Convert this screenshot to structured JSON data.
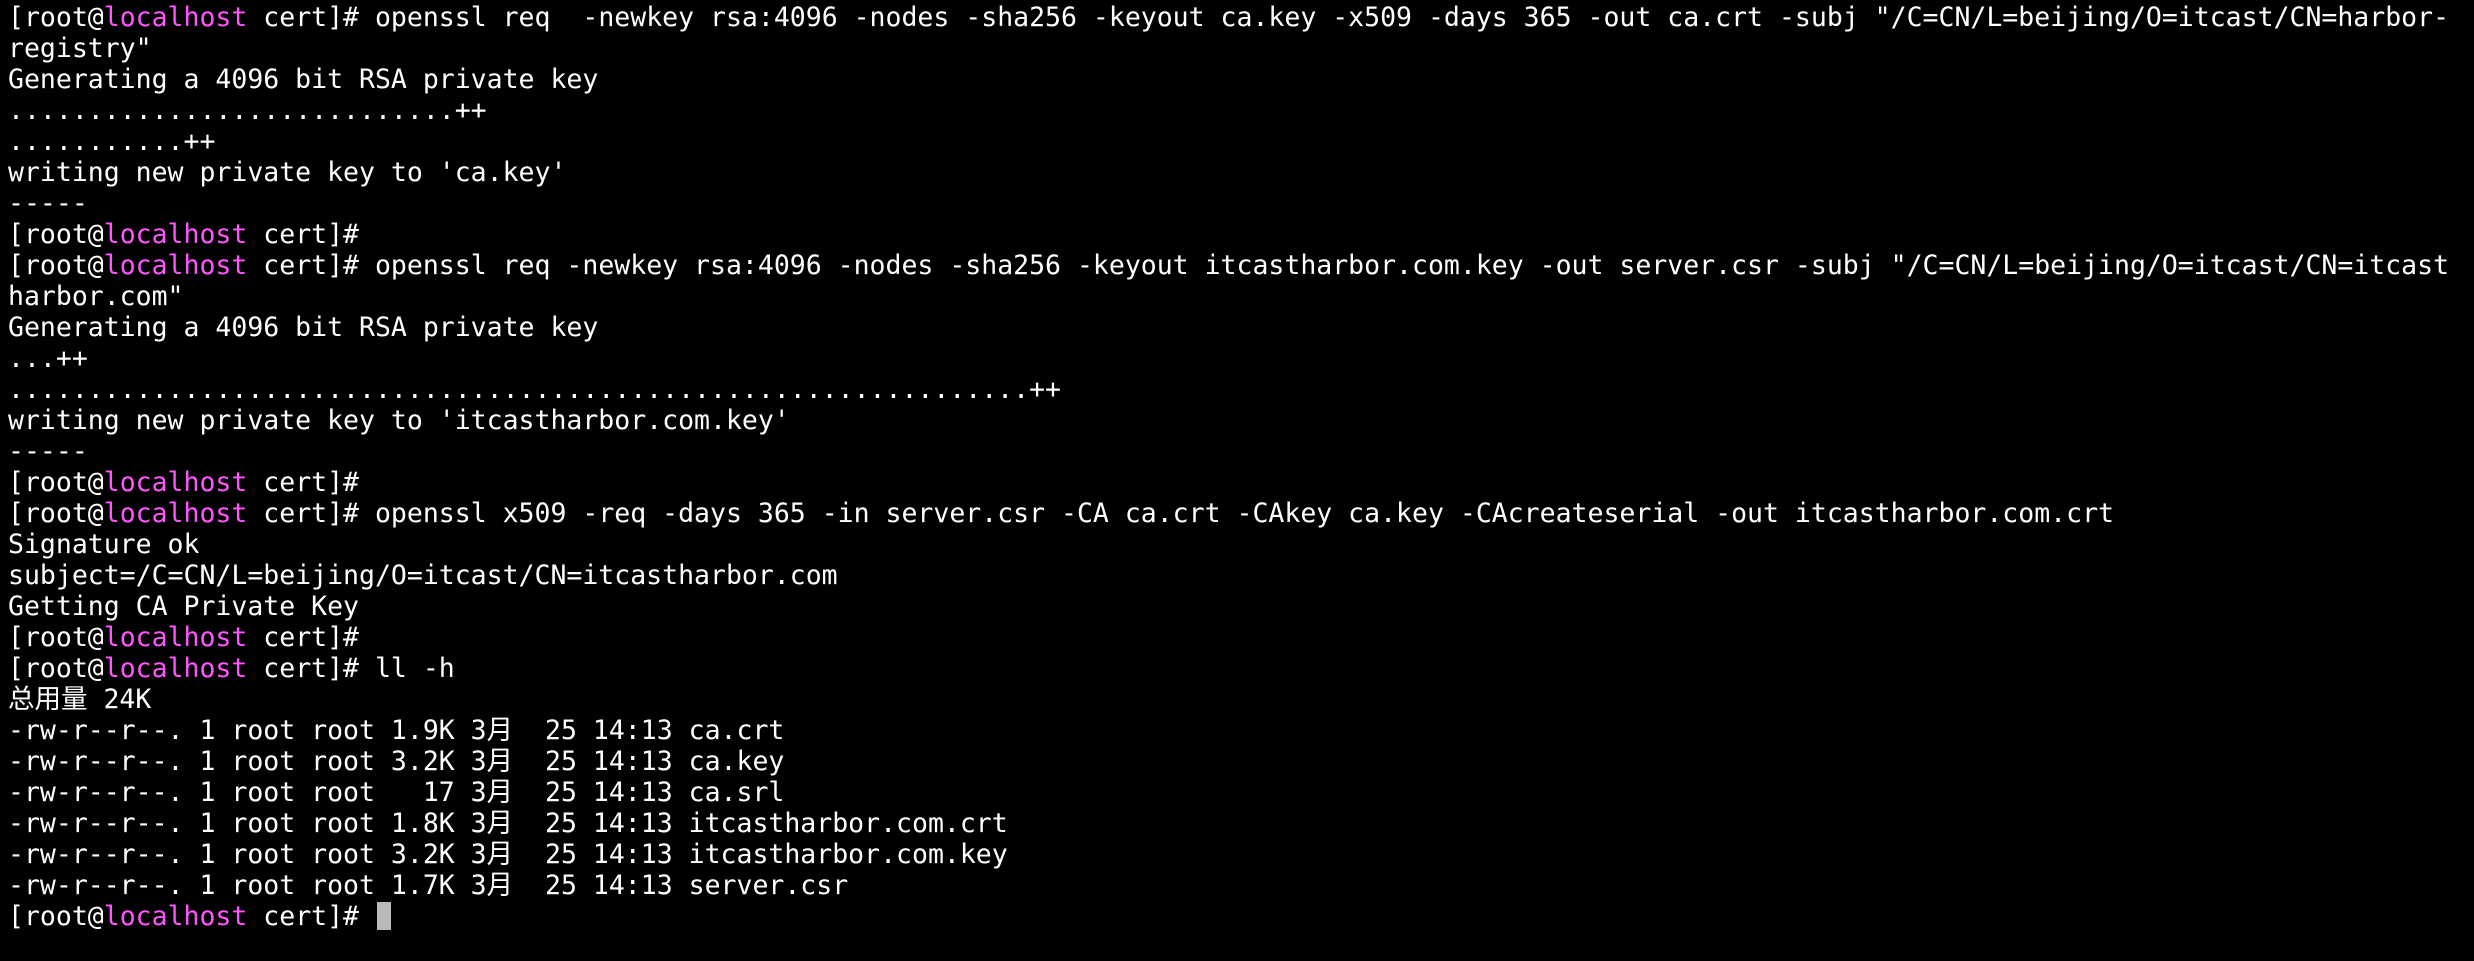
{
  "prompt": {
    "user": "[root@",
    "host": "localhost",
    "rest": " cert]# "
  },
  "cursor_icon": "block-cursor",
  "colors": {
    "background": "#000000",
    "text": "#ffffff",
    "hostname": "#ff55ff",
    "cursor": "#b8b8b8"
  },
  "lines": [
    {
      "type": "prompt",
      "cmd": "openssl req  -newkey rsa:4096 -nodes -sha256 -keyout ca.key -x509 -days 365 -out ca.crt -subj \"/C=CN/L=beijing/O=itcast/CN=harbor-"
    },
    {
      "type": "text",
      "text": "registry\""
    },
    {
      "type": "text",
      "text": "Generating a 4096 bit RSA private key"
    },
    {
      "type": "text",
      "text": "............................++"
    },
    {
      "type": "text",
      "text": "...........++"
    },
    {
      "type": "text",
      "text": "writing new private key to 'ca.key'"
    },
    {
      "type": "text",
      "text": "-----"
    },
    {
      "type": "prompt",
      "cmd": ""
    },
    {
      "type": "prompt",
      "cmd": "openssl req -newkey rsa:4096 -nodes -sha256 -keyout itcastharbor.com.key -out server.csr -subj \"/C=CN/L=beijing/O=itcast/CN=itcast"
    },
    {
      "type": "text",
      "text": "harbor.com\""
    },
    {
      "type": "text",
      "text": "Generating a 4096 bit RSA private key"
    },
    {
      "type": "text",
      "text": "...++"
    },
    {
      "type": "text",
      "text": "................................................................++"
    },
    {
      "type": "text",
      "text": "writing new private key to 'itcastharbor.com.key'"
    },
    {
      "type": "text",
      "text": "-----"
    },
    {
      "type": "prompt",
      "cmd": ""
    },
    {
      "type": "prompt",
      "cmd": "openssl x509 -req -days 365 -in server.csr -CA ca.crt -CAkey ca.key -CAcreateserial -out itcastharbor.com.crt"
    },
    {
      "type": "text",
      "text": "Signature ok"
    },
    {
      "type": "text",
      "text": "subject=/C=CN/L=beijing/O=itcast/CN=itcastharbor.com"
    },
    {
      "type": "text",
      "text": "Getting CA Private Key"
    },
    {
      "type": "prompt",
      "cmd": ""
    },
    {
      "type": "prompt",
      "cmd": "ll -h"
    },
    {
      "type": "text",
      "text": "总用量 24K"
    },
    {
      "type": "text",
      "text": "-rw-r--r--. 1 root root 1.9K 3月  25 14:13 ca.crt"
    },
    {
      "type": "text",
      "text": "-rw-r--r--. 1 root root 3.2K 3月  25 14:13 ca.key"
    },
    {
      "type": "text",
      "text": "-rw-r--r--. 1 root root   17 3月  25 14:13 ca.srl"
    },
    {
      "type": "text",
      "text": "-rw-r--r--. 1 root root 1.8K 3月  25 14:13 itcastharbor.com.crt"
    },
    {
      "type": "text",
      "text": "-rw-r--r--. 1 root root 3.2K 3月  25 14:13 itcastharbor.com.key"
    },
    {
      "type": "text",
      "text": "-rw-r--r--. 1 root root 1.7K 3月  25 14:13 server.csr"
    },
    {
      "type": "prompt",
      "cmd": "",
      "cursor": true
    }
  ]
}
